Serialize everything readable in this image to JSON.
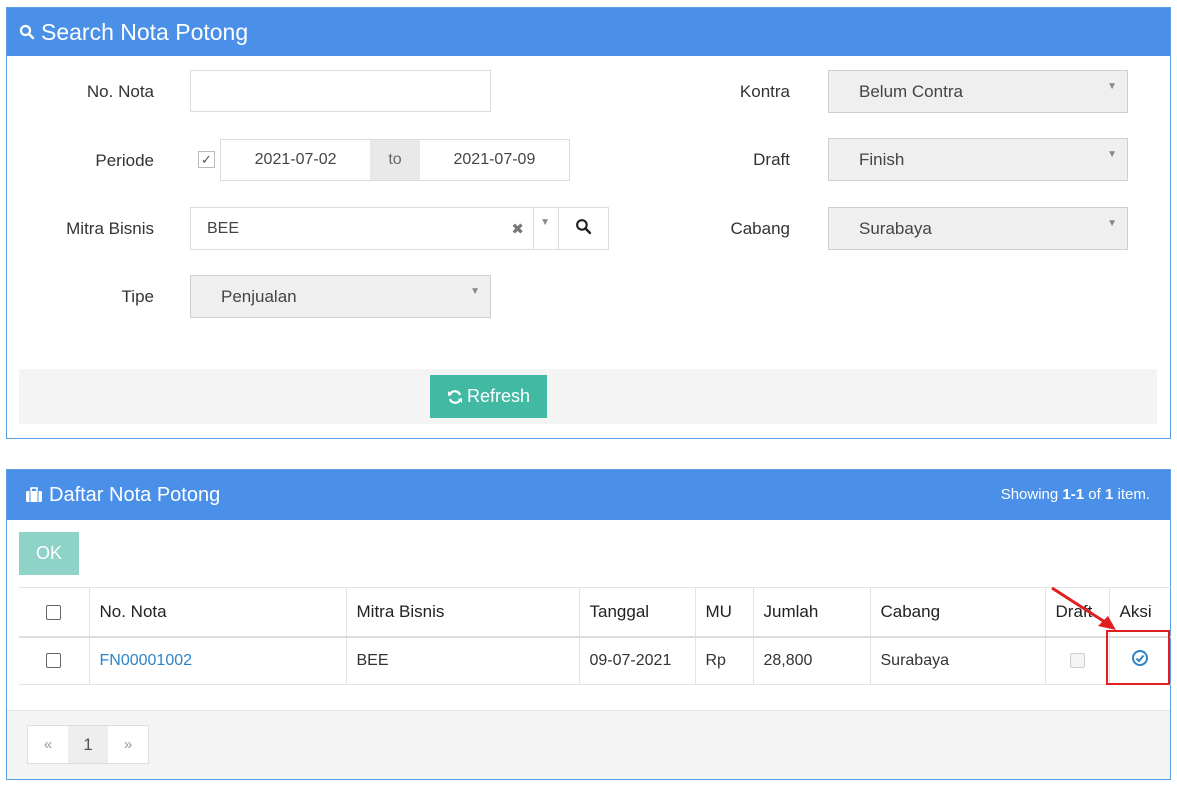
{
  "search_panel": {
    "title": "Search Nota Potong",
    "labels": {
      "no_nota": "No. Nota",
      "periode": "Periode",
      "mitra_bisnis": "Mitra Bisnis",
      "tipe": "Tipe",
      "kontra": "Kontra",
      "draft": "Draft",
      "cabang": "Cabang"
    },
    "no_nota_value": "",
    "periode_checked": true,
    "date_from": "2021-07-02",
    "date_to_label": "to",
    "date_to": "2021-07-09",
    "mitra_bisnis_value": "BEE",
    "tipe_value": "Penjualan",
    "kontra_value": "Belum Contra",
    "draft_value": "Finish",
    "cabang_value": "Surabaya",
    "refresh_label": "Refresh"
  },
  "list_panel": {
    "title": "Daftar Nota Potong",
    "summary": {
      "prefix": "Showing ",
      "range": "1-1",
      "of": " of ",
      "total": "1",
      "suffix": " item."
    },
    "ok_label": "OK",
    "columns": [
      "No. Nota",
      "Mitra Bisnis",
      "Tanggal",
      "MU",
      "Jumlah",
      "Cabang",
      "Draft",
      "Aksi"
    ],
    "rows": [
      {
        "no_nota": "FN00001002",
        "mitra_bisnis": "BEE",
        "tanggal": "09-07-2021",
        "mu": "Rp",
        "jumlah": "28,800",
        "cabang": "Surabaya",
        "draft": false
      }
    ],
    "pagination": {
      "prev": "«",
      "current": "1",
      "next": "»"
    }
  },
  "colors": {
    "header_blue": "#4a90e8",
    "refresh_teal": "#42b9a3",
    "ok_teal_disabled": "#8fd3c8",
    "link_blue": "#2d83c7",
    "highlight_red": "#e02020"
  },
  "icons": {
    "search_heading": "search-icon",
    "refresh": "refresh-icon",
    "list_heading": "briefcase-icon",
    "action": "check-circle-icon"
  }
}
